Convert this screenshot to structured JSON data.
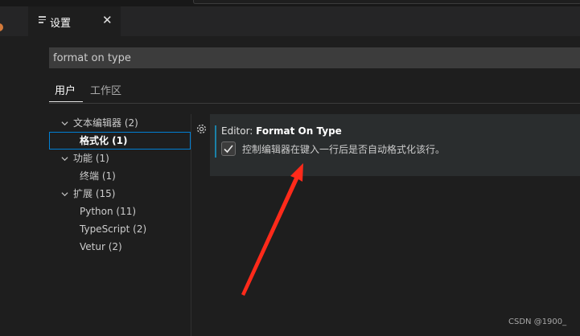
{
  "tab": {
    "icon": "settings-editor-icon",
    "title": "设置",
    "close_glyph": "✕"
  },
  "search": {
    "value": "format on type",
    "placeholder": ""
  },
  "scopes": [
    {
      "label": "用户",
      "active": true
    },
    {
      "label": "工作区",
      "active": false
    }
  ],
  "toc": [
    {
      "label": "文本编辑器 (2)",
      "expanded": true,
      "selected": false
    },
    {
      "label": "格式化 (1)",
      "selected": true
    },
    {
      "label": "功能 (1)",
      "expanded": true,
      "selected": false
    },
    {
      "label": "终端 (1)",
      "selected": false
    },
    {
      "label": "扩展 (15)",
      "expanded": true,
      "selected": false
    },
    {
      "label": "Python (11)",
      "selected": false
    },
    {
      "label": "TypeScript (2)",
      "selected": false
    },
    {
      "label": "Vetur (2)",
      "selected": false
    }
  ],
  "setting": {
    "category": "Editor: ",
    "name": "Format On Type",
    "checked": true,
    "description": "控制编辑器在键入一行后是否自动格式化该行。",
    "gear_icon": "gear-icon"
  },
  "colors": {
    "accent": "#007fd4",
    "annotation_arrow": "#ff2a1a",
    "modified_bar": "#1b81a8"
  },
  "watermark": "CSDN @1900_"
}
